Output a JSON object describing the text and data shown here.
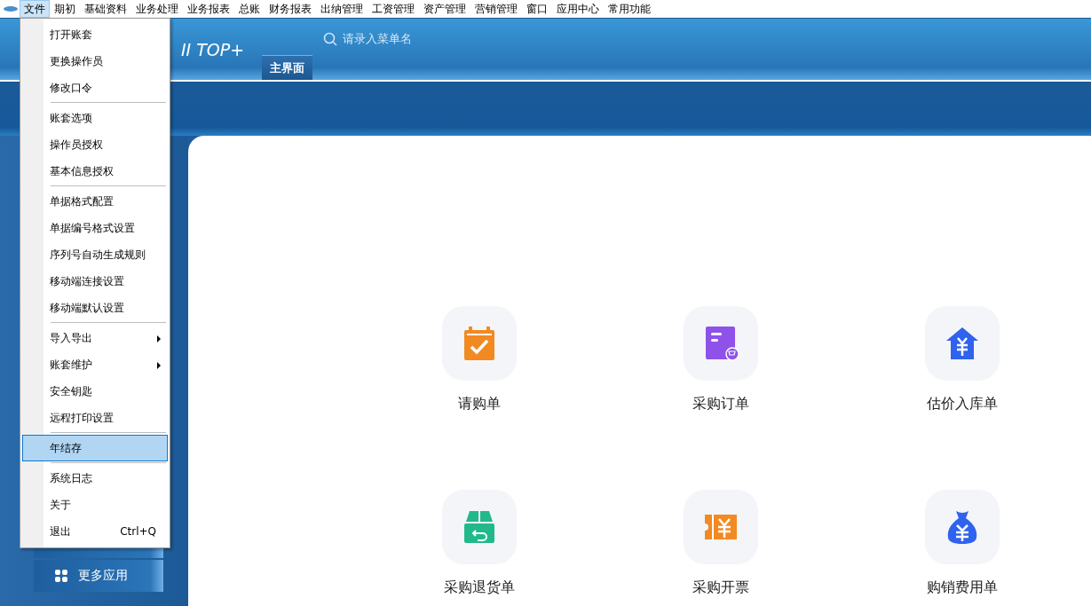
{
  "menubar": [
    {
      "label": "文件",
      "selected": true
    },
    {
      "label": "期初",
      "selected": false
    },
    {
      "label": "基础资料",
      "selected": false
    },
    {
      "label": "业务处理",
      "selected": false
    },
    {
      "label": "业务报表",
      "selected": false
    },
    {
      "label": "总账",
      "selected": false
    },
    {
      "label": "财务报表",
      "selected": false
    },
    {
      "label": "出纳管理",
      "selected": false
    },
    {
      "label": "工资管理",
      "selected": false
    },
    {
      "label": "资产管理",
      "selected": false
    },
    {
      "label": "营销管理",
      "selected": false
    },
    {
      "label": "窗口",
      "selected": false
    },
    {
      "label": "应用中心",
      "selected": false
    },
    {
      "label": "常用功能",
      "selected": false
    }
  ],
  "header": {
    "logo_right": "II TOP+",
    "search": {
      "placeholder": "请录入菜单名"
    },
    "tabs": [
      {
        "label": "主界面",
        "selected": true
      }
    ]
  },
  "sidebar": {
    "items": [
      {
        "label": "更多应用"
      }
    ]
  },
  "file_menu": [
    {
      "kind": "item",
      "label": "打开账套",
      "selected": false
    },
    {
      "kind": "item",
      "label": "更换操作员",
      "selected": false
    },
    {
      "kind": "item",
      "label": "修改口令",
      "selected": false
    },
    {
      "kind": "separator"
    },
    {
      "kind": "item",
      "label": "账套选项",
      "selected": false
    },
    {
      "kind": "item",
      "label": "操作员授权",
      "selected": false
    },
    {
      "kind": "item",
      "label": "基本信息授权",
      "selected": false
    },
    {
      "kind": "separator"
    },
    {
      "kind": "item",
      "label": "单据格式配置",
      "selected": false
    },
    {
      "kind": "item",
      "label": "单据编号格式设置",
      "selected": false
    },
    {
      "kind": "item",
      "label": "序列号自动生成规则",
      "selected": false
    },
    {
      "kind": "item",
      "label": "移动端连接设置",
      "selected": false
    },
    {
      "kind": "item",
      "label": "移动端默认设置",
      "selected": false
    },
    {
      "kind": "separator"
    },
    {
      "kind": "submenu",
      "label": "导入导出",
      "selected": false
    },
    {
      "kind": "submenu",
      "label": "账套维护",
      "selected": false
    },
    {
      "kind": "item",
      "label": "安全钥匙",
      "selected": false
    },
    {
      "kind": "item",
      "label": "远程打印设置",
      "selected": false
    },
    {
      "kind": "separator"
    },
    {
      "kind": "item",
      "label": "年结存",
      "selected": true
    },
    {
      "kind": "separator"
    },
    {
      "kind": "item",
      "label": "系统日志",
      "selected": false
    },
    {
      "kind": "item",
      "label": "关于",
      "selected": false
    },
    {
      "kind": "item",
      "label": "退出",
      "shortcut": "Ctrl+Q",
      "selected": false
    }
  ],
  "apps": [
    {
      "kind": "calendar-check",
      "label": "请购单",
      "color": "#f28a22"
    },
    {
      "kind": "doc-cart",
      "label": "采购订单",
      "color": "#8e52ea"
    },
    {
      "kind": "house-yen",
      "label": "估价入库单",
      "color": "#2f62ee"
    },
    {
      "kind": "box-return",
      "label": "采购退货单",
      "color": "#22b98a"
    },
    {
      "kind": "ticket-yen",
      "label": "采购开票",
      "color": "#f28a22"
    },
    {
      "kind": "bag-yen",
      "label": "购销费用单",
      "color": "#2f62ee"
    }
  ]
}
